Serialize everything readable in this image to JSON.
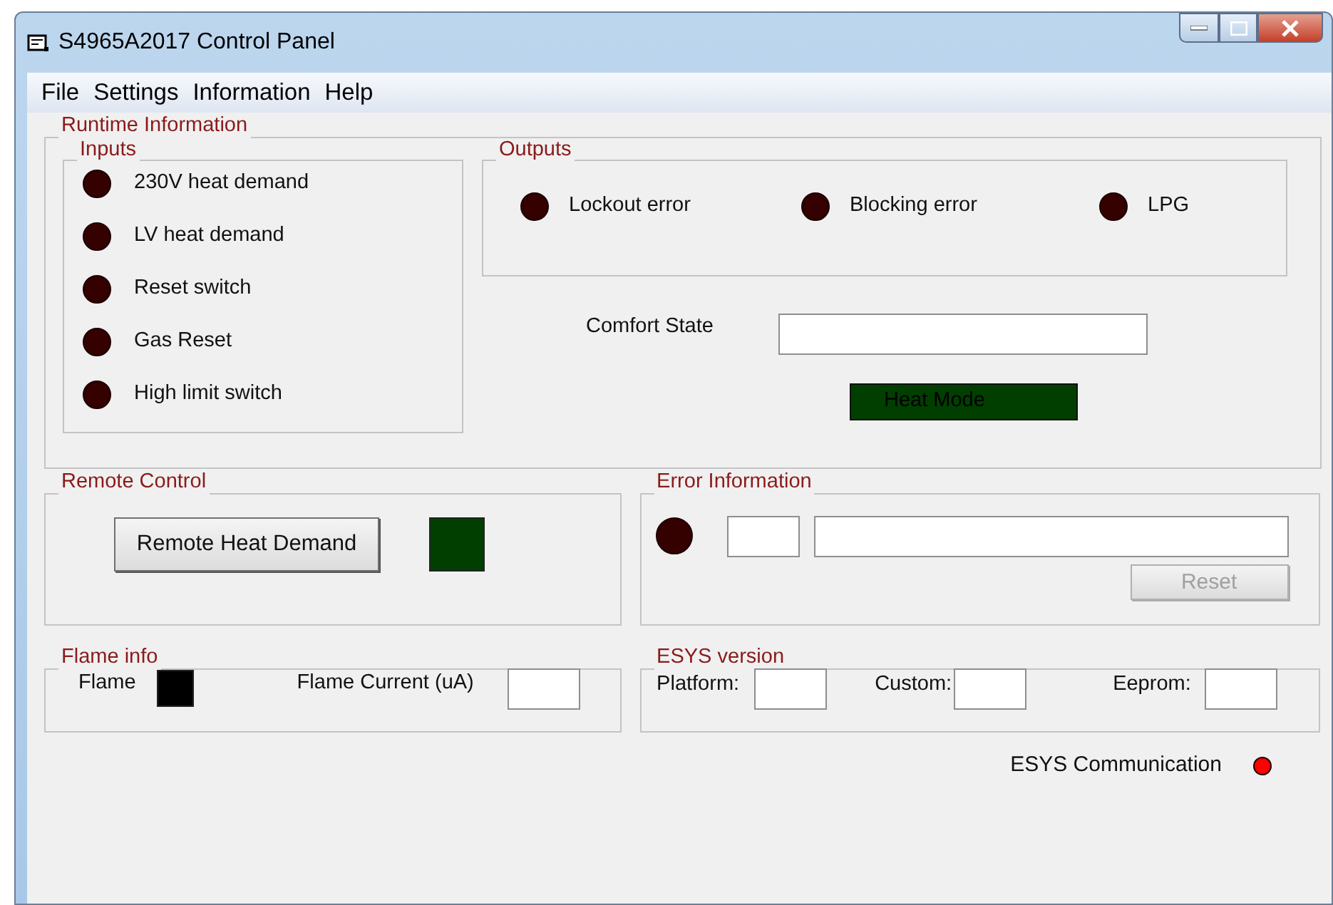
{
  "window": {
    "title": "S4965A2017 Control Panel"
  },
  "menu": [
    "File",
    "Settings",
    "Information",
    "Help"
  ],
  "runtime": {
    "title": "Runtime Information",
    "inputs": {
      "title": "Inputs",
      "items": [
        {
          "label": "230V heat demand",
          "on": false
        },
        {
          "label": "LV heat demand",
          "on": false
        },
        {
          "label": "Reset switch",
          "on": false
        },
        {
          "label": "Gas Reset",
          "on": false
        },
        {
          "label": "High limit switch",
          "on": false
        }
      ]
    },
    "outputs": {
      "title": "Outputs",
      "items": [
        {
          "label": "Lockout error",
          "on": false
        },
        {
          "label": "Blocking error",
          "on": false
        },
        {
          "label": "LPG",
          "on": false
        }
      ]
    },
    "comfort_state": {
      "label": "Comfort State"
    },
    "heat_mode": {
      "label": "Heat Mode",
      "color": "#003f00"
    }
  },
  "remote_control": {
    "title": "Remote Control",
    "button": "Remote Heat Demand",
    "indicator": {
      "color": "#003f00"
    }
  },
  "error_information": {
    "title": "Error Information",
    "led_on": false,
    "reset": {
      "label": "Reset",
      "disabled": true
    }
  },
  "flame_info": {
    "title": "Flame info",
    "flame": {
      "label": "Flame",
      "color": "#000000"
    },
    "current_label": "Flame Current (uA)"
  },
  "esys_version": {
    "title": "ESYS version",
    "fields": [
      "Platform:",
      "Custom:",
      "Eeprom:"
    ]
  },
  "esys_communication": {
    "label": "ESYS Communication",
    "on": true
  }
}
